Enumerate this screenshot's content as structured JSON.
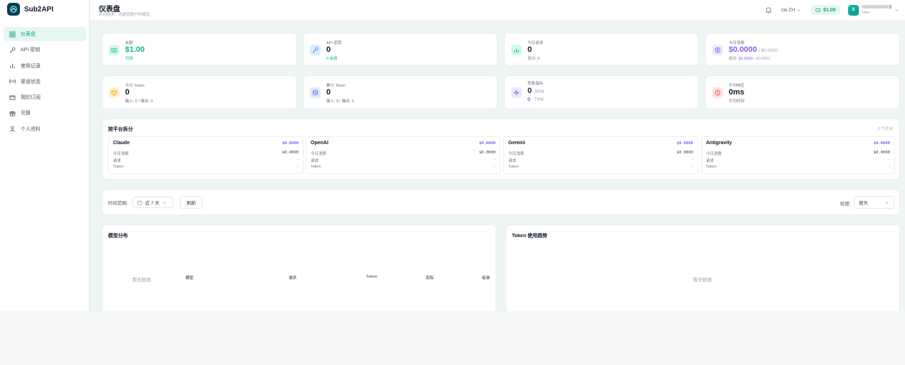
{
  "brand": {
    "name": "Sub2API"
  },
  "sidebar": {
    "items": [
      {
        "label": "仪表盘",
        "icon": "dashboard-icon",
        "active": true
      },
      {
        "label": "API 密钥",
        "icon": "key-icon"
      },
      {
        "label": "使用记录",
        "icon": "chart-icon"
      },
      {
        "label": "渠道状态",
        "icon": "signal-icon"
      },
      {
        "label": "我的订阅",
        "icon": "card-icon"
      },
      {
        "label": "兑换",
        "icon": "gift-icon"
      },
      {
        "label": "个人资料",
        "icon": "user-icon"
      }
    ]
  },
  "header": {
    "title": "仪表盘",
    "subtitle": "欢迎回来！这是您账户的概览。",
    "lang_flag": "CN",
    "lang_code": "ZH",
    "balance": "$1.00",
    "user_suffix": "3",
    "user_role": "User",
    "avatar_initial": "S"
  },
  "stats_row1": [
    {
      "label": "余额",
      "value": "$1.00",
      "sub": "可用",
      "icon": "wallet-icon"
    },
    {
      "label": "API 密钥",
      "value": "0",
      "sub": "0 启用",
      "icon": "key-icon"
    },
    {
      "label": "今日请求",
      "value": "0",
      "sub": "总计: 0",
      "icon": "bar-chart-icon"
    },
    {
      "label": "今日消费",
      "value": "$0.0000",
      "value_suffix": "/ $0.0000",
      "sub_prefix": "总计:",
      "sub_value1": "$0.0000",
      "sub_value2": "/ $0.0000",
      "icon": "dollar-icon"
    }
  ],
  "stats_row2": [
    {
      "label": "今日 Token",
      "value": "0",
      "sub": "输入: 0 / 输出: 0",
      "icon": "cube-icon"
    },
    {
      "label": "累计 Token",
      "value": "0",
      "sub": "输入: 0 / 输出: 0",
      "icon": "database-icon"
    },
    {
      "label": "性能指标",
      "value": "0",
      "unit1": "RPM",
      "value2": "0",
      "unit2": "TPM",
      "icon": "bolt-icon"
    },
    {
      "label": "平均响应",
      "value": "0ms",
      "sub": "平均时间",
      "icon": "clock-icon"
    }
  ],
  "platforms": {
    "title": "按平台拆分",
    "count": "0 个平台",
    "row_labels": [
      "今日消费",
      "请求",
      "Token"
    ],
    "items": [
      {
        "name": "Claude",
        "cost": "$0.0000",
        "today": "$0.0000",
        "requests": "-",
        "tokens": "-"
      },
      {
        "name": "OpenAI",
        "cost": "$0.0000",
        "today": "$0.0000",
        "requests": "-",
        "tokens": "-"
      },
      {
        "name": "Gemini",
        "cost": "$0.0000",
        "today": "$0.0000",
        "requests": "-",
        "tokens": "-"
      },
      {
        "name": "Antigravity",
        "cost": "$0.0000",
        "today": "$0.0000",
        "requests": "-",
        "tokens": "-"
      }
    ]
  },
  "filters": {
    "time_range_label": "时间范围:",
    "time_range_value": "近 7 天",
    "refresh_label": "刷新",
    "granularity_label": "粒度:",
    "granularity_value": "按天"
  },
  "model_dist": {
    "title": "模型分布",
    "empty": "暂无数据",
    "columns": [
      "模型",
      "请求",
      "Token",
      "实际",
      "标准"
    ]
  },
  "token_trend": {
    "title": "Token 使用趋势",
    "empty": "暂无数据"
  }
}
